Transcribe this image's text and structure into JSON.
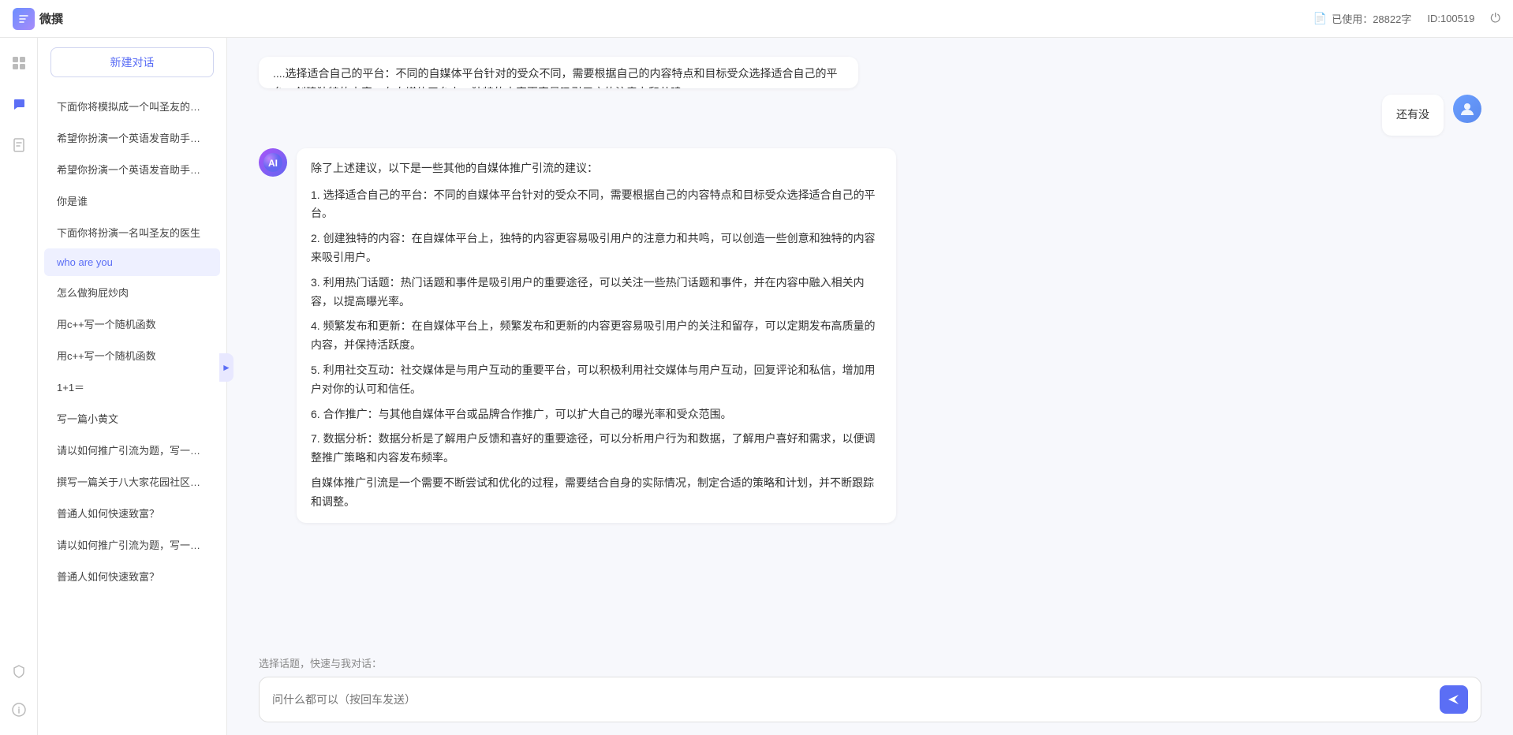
{
  "topbar": {
    "logo_text": "微撰",
    "usage_label": "已使用：28822字",
    "id_label": "ID:100519"
  },
  "sidebar": {
    "new_btn_label": "新建对话",
    "items": [
      {
        "id": 1,
        "label": "下面你将模拟成一个叫圣友的程序员，我说..."
      },
      {
        "id": 2,
        "label": "希望你扮演一个英语发音助手，我提供给你..."
      },
      {
        "id": 3,
        "label": "希望你扮演一个英语发音助手，我提供给你..."
      },
      {
        "id": 4,
        "label": "你是谁"
      },
      {
        "id": 5,
        "label": "下面你将扮演一名叫圣友的医生"
      },
      {
        "id": 6,
        "label": "who are you",
        "active": true
      },
      {
        "id": 7,
        "label": "怎么做狗屁炒肉"
      },
      {
        "id": 8,
        "label": "用c++写一个随机函数"
      },
      {
        "id": 9,
        "label": "用c++写一个随机函数"
      },
      {
        "id": 10,
        "label": "1+1＝"
      },
      {
        "id": 11,
        "label": "写一篇小黄文"
      },
      {
        "id": 12,
        "label": "请以如何推广引流为题，写一篇大纲"
      },
      {
        "id": 13,
        "label": "撰写一篇关于八大家花园社区一刻钟便民生..."
      },
      {
        "id": 14,
        "label": "普通人如何快速致富？"
      },
      {
        "id": 15,
        "label": "请以如何推广引流为题，写一篇大纲"
      },
      {
        "id": 16,
        "label": "普通人如何快速致富？"
      }
    ],
    "bottom_items": [
      {
        "id": "security",
        "label": "安全"
      },
      {
        "id": "info",
        "label": "信息"
      }
    ]
  },
  "chat": {
    "partial_text": "....选择适合自己的平台：不同的自媒体平台针对的受众不同，需要根据自己的内容特点和目标受众选择适合自己的平台。创建独特的内容：在自媒体平台上，独特的内容更容易吸引用户的注意力和共鸣，可以创造一些创意和独特的内容来吸引用户。利用热门话题...",
    "user_message": "还有没",
    "ai_response_paragraphs": [
      "除了上述建议，以下是一些其他的自媒体推广引流的建议：",
      "1. 选择适合自己的平台：不同的自媒体平台针对的受众不同，需要根据自己的内容特点和目标受众选择适合自己的平台。",
      "2. 创建独特的内容：在自媒体平台上，独特的内容更容易吸引用户的注意力和共鸣，可以创造一些创意和独特的内容来吸引用户。",
      "3. 利用热门话题：热门话题和事件是吸引用户的重要途径，可以关注一些热门话题和事件，并在内容中融入相关内容，以提高曝光率。",
      "4. 频繁发布和更新：在自媒体平台上，频繁发布和更新的内容更容易吸引用户的关注和留存，可以定期发布高质量的内容，并保持活跃度。",
      "5. 利用社交互动：社交媒体是与用户互动的重要平台，可以积极利用社交媒体与用户互动，回复评论和私信，增加用户对你的认可和信任。",
      "6. 合作推广：与其他自媒体平台或品牌合作推广，可以扩大自己的曝光率和受众范围。",
      "7. 数据分析：数据分析是了解用户反馈和喜好的重要途径，可以分析用户行为和数据，了解用户喜好和需求，以便调整推广策略和内容发布频率。",
      "自媒体推广引流是一个需要不断尝试和优化的过程，需要结合自身的实际情况，制定合适的策略和计划，并不断跟踪和调整。"
    ],
    "quick_topic_label": "选择话题，快速与我对话：",
    "input_placeholder": "问什么都可以（按回车发送）",
    "send_icon": "▶"
  }
}
